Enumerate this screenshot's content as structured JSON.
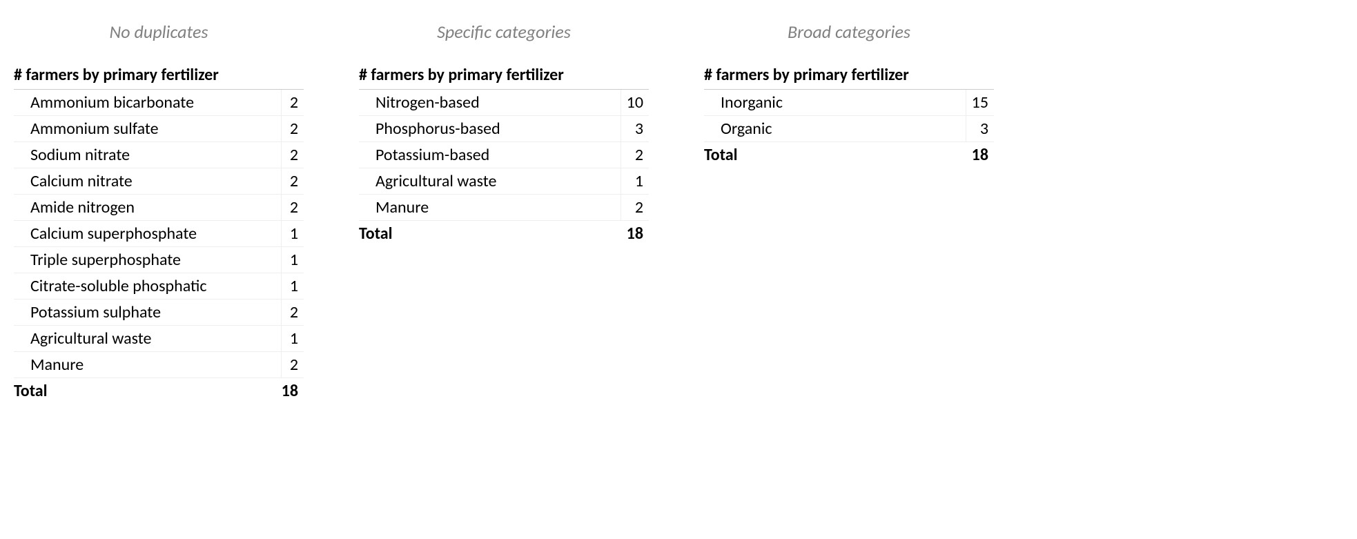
{
  "blocks": [
    {
      "caption": "No duplicates",
      "title": "# farmers by primary fertilizer",
      "rows": [
        {
          "label": "Ammonium bicarbonate",
          "value": 2
        },
        {
          "label": "Ammonium sulfate",
          "value": 2
        },
        {
          "label": "Sodium nitrate",
          "value": 2
        },
        {
          "label": "Calcium nitrate",
          "value": 2
        },
        {
          "label": "Amide nitrogen",
          "value": 2
        },
        {
          "label": "Calcium superphosphate",
          "value": 1
        },
        {
          "label": "Triple superphosphate",
          "value": 1
        },
        {
          "label": "Citrate-soluble phosphatic",
          "value": 1
        },
        {
          "label": "Potassium sulphate",
          "value": 2
        },
        {
          "label": "Agricultural waste",
          "value": 1
        },
        {
          "label": "Manure",
          "value": 2
        }
      ],
      "total_label": "Total",
      "total_value": 18
    },
    {
      "caption": "Specific categories",
      "title": "# farmers by primary fertilizer",
      "rows": [
        {
          "label": "Nitrogen-based",
          "value": 10
        },
        {
          "label": "Phosphorus-based",
          "value": 3
        },
        {
          "label": "Potassium-based",
          "value": 2
        },
        {
          "label": "Agricultural waste",
          "value": 1
        },
        {
          "label": "Manure",
          "value": 2
        }
      ],
      "total_label": "Total",
      "total_value": 18
    },
    {
      "caption": "Broad categories",
      "title": "# farmers by primary fertilizer",
      "rows": [
        {
          "label": "Inorganic",
          "value": 15
        },
        {
          "label": "Organic",
          "value": 3
        }
      ],
      "total_label": "Total",
      "total_value": 18
    }
  ]
}
